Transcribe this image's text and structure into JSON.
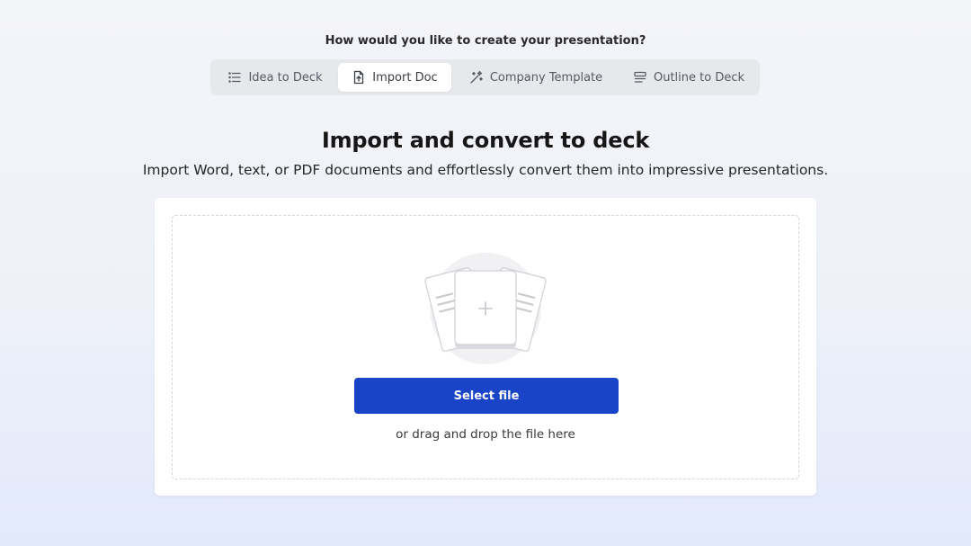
{
  "header": {
    "question": "How would you like to create your presentation?"
  },
  "tabs": [
    {
      "label": "Idea to Deck",
      "icon": "list-icon",
      "active": false
    },
    {
      "label": "Import Doc",
      "icon": "file-upload-icon",
      "active": true
    },
    {
      "label": "Company Template",
      "icon": "magic-wand-icon",
      "active": false
    },
    {
      "label": "Outline to Deck",
      "icon": "outline-icon",
      "active": false
    }
  ],
  "main": {
    "title": "Import and convert to deck",
    "subtitle": "Import Word, text, or PDF documents and effortlessly convert them into impressive presentations."
  },
  "upload": {
    "illustration_icon": "documents-plus-icon",
    "button_label": "Select file",
    "hint": "or drag and drop the file here"
  },
  "colors": {
    "accent": "#1a44c8",
    "tab_bar_bg": "#e7e8ec",
    "active_tab_bg": "#ffffff"
  }
}
